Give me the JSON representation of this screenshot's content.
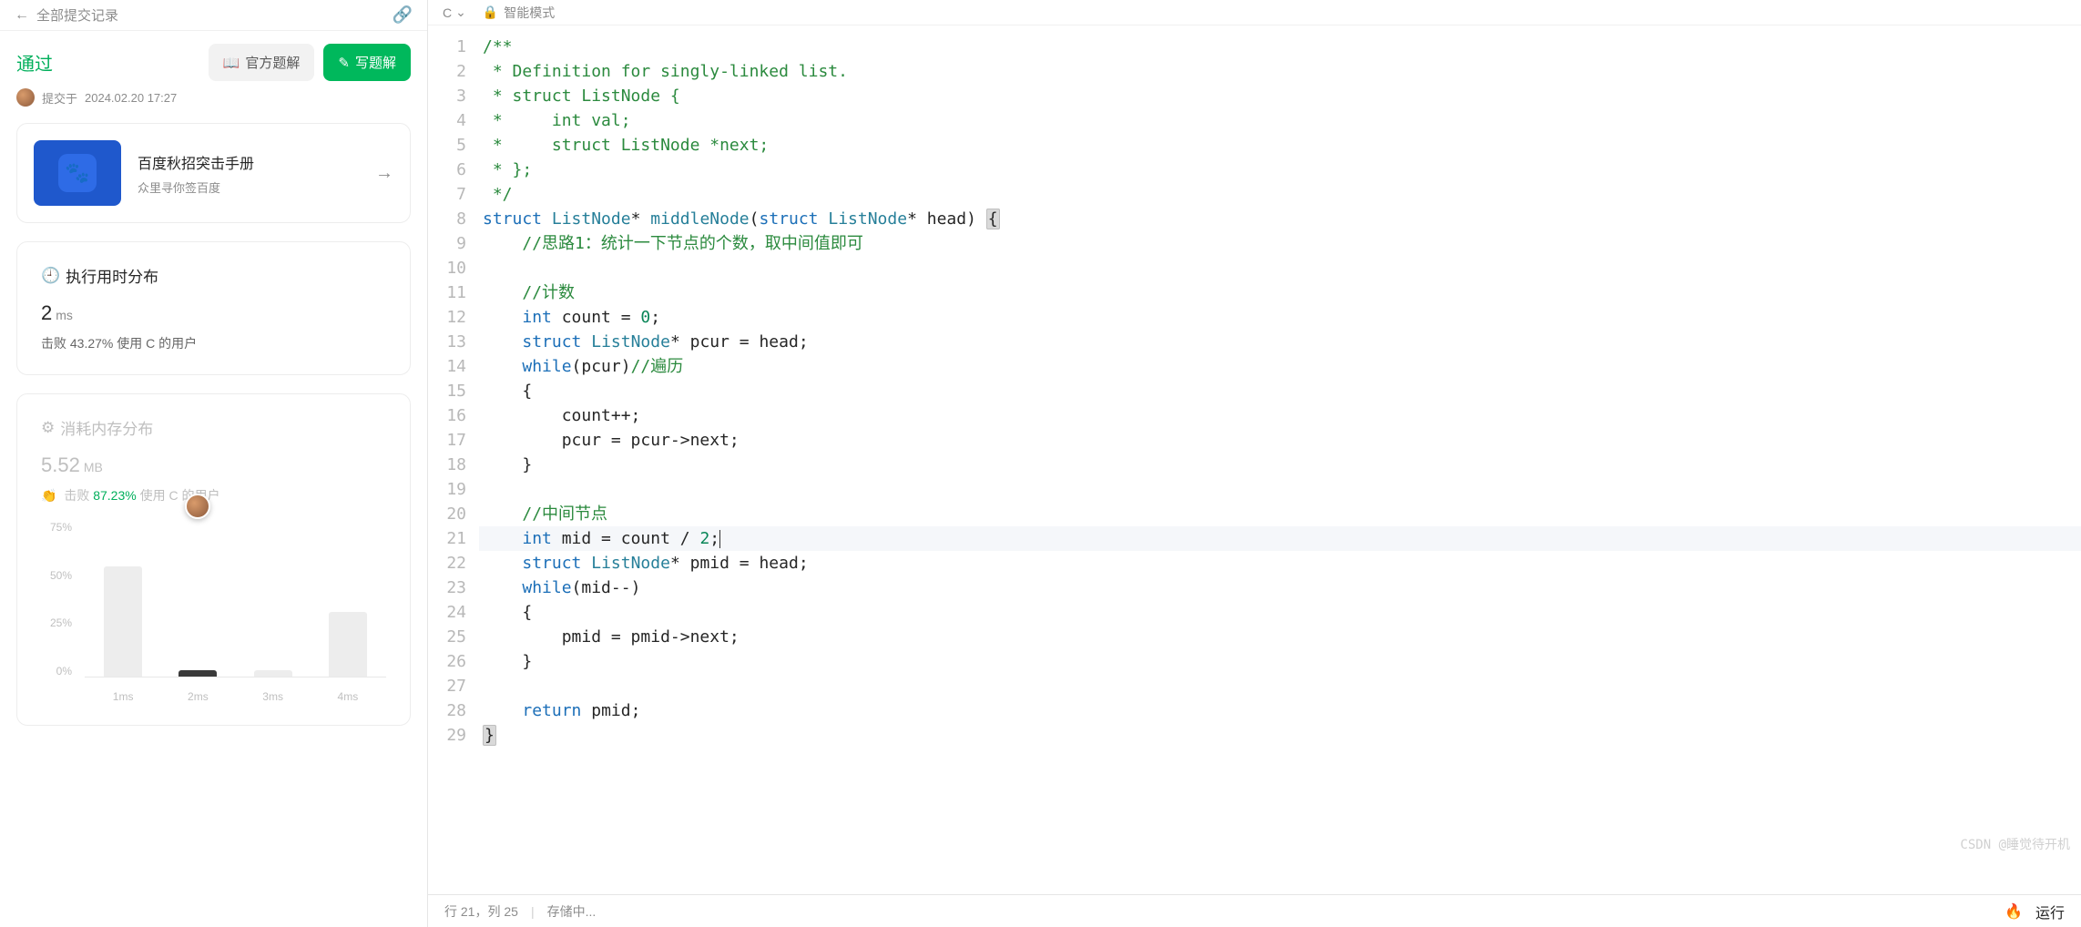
{
  "left": {
    "top_title": "全部提交记录",
    "status": "通过",
    "official_btn": "官方题解",
    "write_btn": "写题解",
    "submit_prefix": "提交于",
    "submit_time": "2024.02.20 17:27",
    "promo": {
      "title": "百度秋招突击手册",
      "sub": "众里寻你签百度"
    },
    "runtime": {
      "title": "执行用时分布",
      "value": "2",
      "unit": "ms",
      "beat_prefix": "击败",
      "beat_pct": "43.27%",
      "beat_suffix": "使用 C 的用户"
    },
    "memory": {
      "title": "消耗内存分布",
      "value": "5.52",
      "unit": "MB",
      "beat_prefix": "击败",
      "beat_pct": "87.23%",
      "beat_suffix": "使用 C 的用户"
    }
  },
  "editor_top": {
    "lang": "C",
    "mode": "智能模式"
  },
  "status_bar": {
    "pos": "行 21，列 25",
    "saving": "存储中...",
    "run": "运行"
  },
  "watermark": "CSDN @睡觉待开机",
  "chart_data": {
    "type": "bar",
    "title": "执行用时分布",
    "xlabel": "",
    "ylabel": "",
    "categories": [
      "1ms",
      "2ms",
      "3ms",
      "4ms"
    ],
    "values": [
      53,
      3,
      3,
      31
    ],
    "y_ticks": [
      "75%",
      "50%",
      "25%",
      "0%"
    ],
    "ylim": [
      0,
      75
    ],
    "highlight_index": 1
  },
  "code": {
    "lines": [
      {
        "n": 1,
        "cls": "c",
        "t": "/**"
      },
      {
        "n": 2,
        "cls": "c",
        "t": " * Definition for singly-linked list."
      },
      {
        "n": 3,
        "cls": "c",
        "t": " * struct ListNode {"
      },
      {
        "n": 4,
        "cls": "c",
        "t": " *     int val;"
      },
      {
        "n": 5,
        "cls": "c",
        "t": " *     struct ListNode *next;"
      },
      {
        "n": 6,
        "cls": "c",
        "t": " * };"
      },
      {
        "n": 7,
        "cls": "c",
        "t": " */"
      },
      {
        "n": 8,
        "cls": "sig"
      },
      {
        "n": 9,
        "cls": "cmt",
        "t": "    //思路1：统计一下节点的个数，取中间值即可"
      },
      {
        "n": 10,
        "cls": "p",
        "t": ""
      },
      {
        "n": 11,
        "cls": "cmt",
        "t": "    //计数"
      },
      {
        "n": 12,
        "cls": "s1"
      },
      {
        "n": 13,
        "cls": "s2"
      },
      {
        "n": 14,
        "cls": "s3"
      },
      {
        "n": 15,
        "cls": "p",
        "t": "    {"
      },
      {
        "n": 16,
        "cls": "p",
        "t": "        count++;"
      },
      {
        "n": 17,
        "cls": "p",
        "t": "        pcur = pcur->next;"
      },
      {
        "n": 18,
        "cls": "p",
        "t": "    }"
      },
      {
        "n": 19,
        "cls": "p",
        "t": ""
      },
      {
        "n": 20,
        "cls": "cmt",
        "t": "    //中间节点"
      },
      {
        "n": 21,
        "cls": "s4",
        "hl": true
      },
      {
        "n": 22,
        "cls": "s5"
      },
      {
        "n": 23,
        "cls": "s6"
      },
      {
        "n": 24,
        "cls": "p",
        "t": "    {"
      },
      {
        "n": 25,
        "cls": "p",
        "t": "        pmid = pmid->next;"
      },
      {
        "n": 26,
        "cls": "p",
        "t": "    }"
      },
      {
        "n": 27,
        "cls": "p",
        "t": ""
      },
      {
        "n": 28,
        "cls": "s7"
      },
      {
        "n": 29,
        "cls": "end"
      }
    ]
  }
}
